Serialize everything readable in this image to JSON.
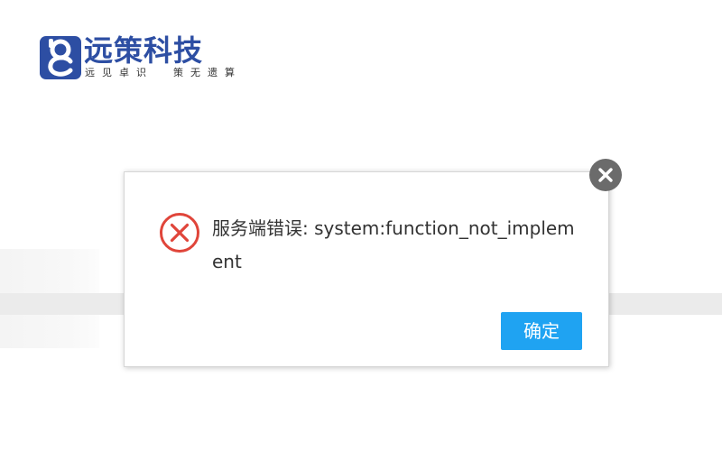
{
  "brand": {
    "name": "远策科技",
    "slogan_part1": [
      "远",
      "见",
      "卓",
      "识"
    ],
    "slogan_part2": [
      "策",
      "无",
      "遗",
      "算"
    ],
    "logo_icon": "yc-brand-logo-icon",
    "brand_color": "#2d4ea3"
  },
  "dialog": {
    "message": "服务端错误: system:function_not_implement",
    "confirm_label": "确定",
    "status_icon": "error-circle-icon",
    "close_icon": "close-icon",
    "accent_color": "#1fa3f2",
    "error_color": "#e0453a"
  }
}
